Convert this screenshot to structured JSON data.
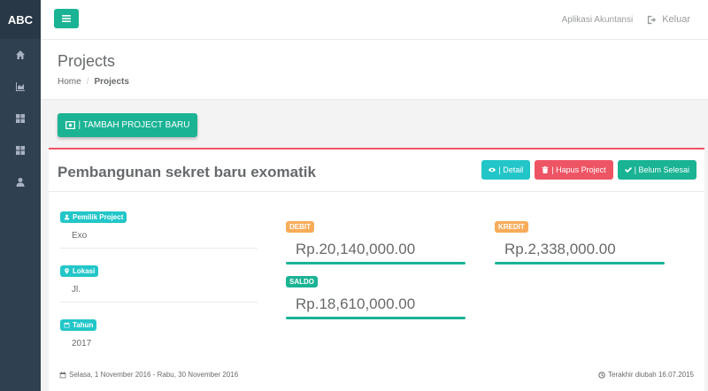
{
  "brand": "ABC",
  "sidebar": {
    "items": [
      {
        "icon": "home-icon"
      },
      {
        "icon": "area-chart-icon"
      },
      {
        "icon": "th-large-icon"
      },
      {
        "icon": "th-large-icon"
      },
      {
        "icon": "user-icon"
      }
    ]
  },
  "topbar": {
    "app_name": "Aplikasi Akuntansi",
    "logout_label": "Keluar"
  },
  "heading": {
    "title": "Projects",
    "breadcrumb": [
      "Home",
      "Projects"
    ]
  },
  "add_project_label": "| TAMBAH PROJECT BARU",
  "project": {
    "title": "Pembangunan sekret baru exomatik",
    "buttons": {
      "detail": "| Detail",
      "delete": "| Hapus Project",
      "status": "| Belum Selesai"
    },
    "owner_label": "Pemilik Project",
    "owner": "Exo",
    "location_label": "Lokasi",
    "location": "Jl.",
    "year_label": "Tahun",
    "year": "2017",
    "debit_label": "DEBIT",
    "debit": "Rp.20,140,000.00",
    "credit_label": "KREDIT",
    "credit": "Rp.2,338,000.00",
    "saldo_label": "SALDO",
    "saldo": "Rp.18,610,000.00",
    "period": "Selasa, 1 November 2016 - Rabu, 30 November 2016",
    "last_modified": "Terakhir diubah 16.07.2015"
  },
  "colors": {
    "sidebar": "#2f4050",
    "primary": "#1ab394",
    "info": "#23c6c8",
    "danger": "#ed5565",
    "warning": "#f8ac59"
  }
}
